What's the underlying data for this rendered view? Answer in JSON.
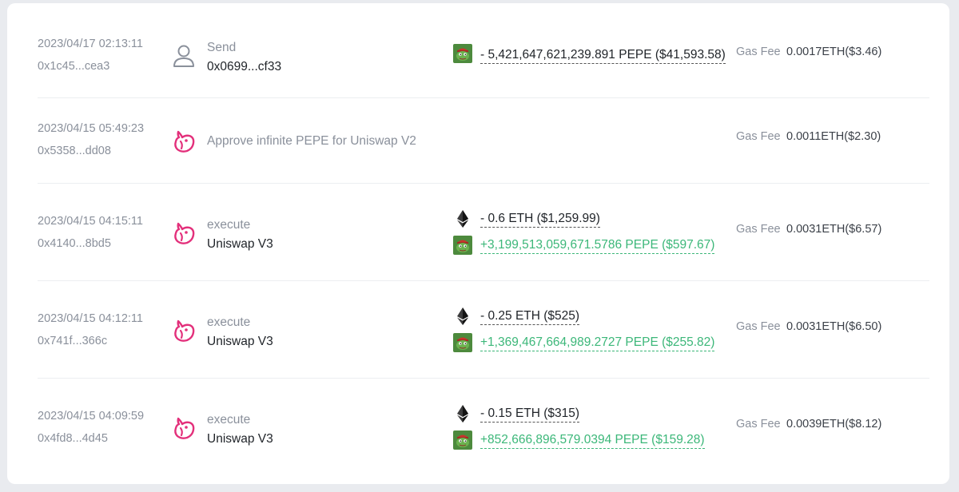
{
  "colors": {
    "negative": "#1f2328",
    "positive": "#3cb779",
    "uniswap": "#e3307b"
  },
  "gas_label": "Gas Fee",
  "rows": [
    {
      "time": "2023/04/17 02:13:11",
      "hash": "0x1c45...cea3",
      "icon": "user-icon",
      "action": "Send",
      "target": "0x0699...cf33",
      "amounts": [
        {
          "token": "PEPE",
          "text": "- 5,421,647,621,239.891 PEPE ($41,593.58)",
          "sign": "neg"
        }
      ],
      "gas": "0.0017ETH($3.46)"
    },
    {
      "time": "2023/04/15 05:49:23",
      "hash": "0x5358...dd08",
      "icon": "uniswap-icon",
      "action": "Approve infinite PEPE for Uniswap V2",
      "target": "",
      "amounts": [],
      "gas": "0.0011ETH($2.30)"
    },
    {
      "time": "2023/04/15 04:15:11",
      "hash": "0x4140...8bd5",
      "icon": "uniswap-icon",
      "action": "execute",
      "target": "Uniswap V3",
      "amounts": [
        {
          "token": "ETH",
          "text": "- 0.6 ETH ($1,259.99)",
          "sign": "neg"
        },
        {
          "token": "PEPE",
          "text": "+3,199,513,059,671.5786 PEPE ($597.67)",
          "sign": "pos"
        }
      ],
      "gas": "0.0031ETH($6.57)"
    },
    {
      "time": "2023/04/15 04:12:11",
      "hash": "0x741f...366c",
      "icon": "uniswap-icon",
      "action": "execute",
      "target": "Uniswap V3",
      "amounts": [
        {
          "token": "ETH",
          "text": "- 0.25 ETH ($525)",
          "sign": "neg"
        },
        {
          "token": "PEPE",
          "text": "+1,369,467,664,989.2727 PEPE ($255.82)",
          "sign": "pos"
        }
      ],
      "gas": "0.0031ETH($6.50)"
    },
    {
      "time": "2023/04/15 04:09:59",
      "hash": "0x4fd8...4d45",
      "icon": "uniswap-icon",
      "action": "execute",
      "target": "Uniswap V3",
      "amounts": [
        {
          "token": "ETH",
          "text": "- 0.15 ETH ($315)",
          "sign": "neg"
        },
        {
          "token": "PEPE",
          "text": "+852,666,896,579.0394 PEPE ($159.28)",
          "sign": "pos"
        }
      ],
      "gas": "0.0039ETH($8.12)"
    }
  ]
}
